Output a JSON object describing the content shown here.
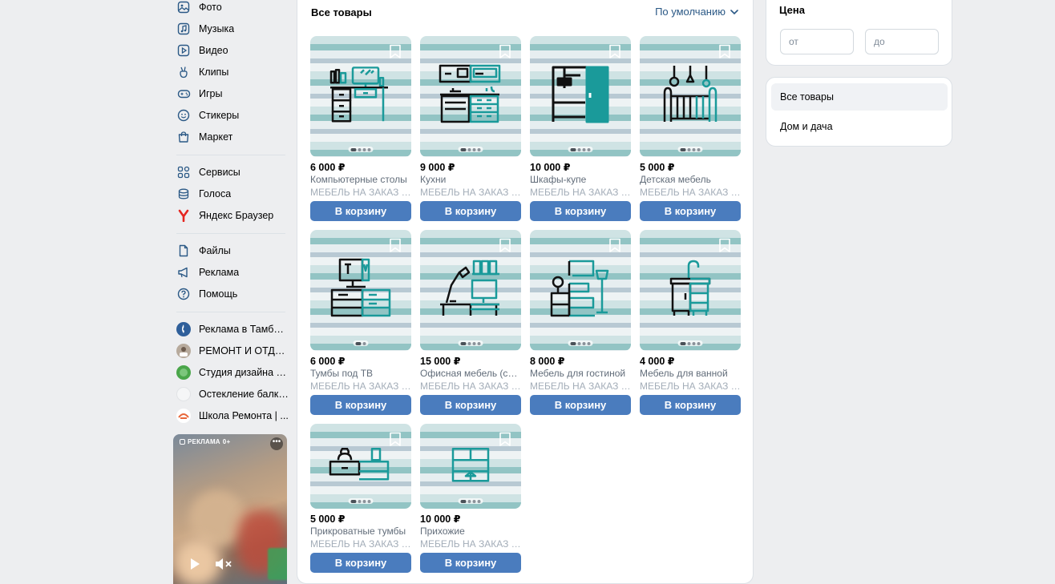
{
  "nav": {
    "items": [
      {
        "label": "Фото",
        "icon": "photo-icon"
      },
      {
        "label": "Музыка",
        "icon": "music-icon"
      },
      {
        "label": "Видео",
        "icon": "video-icon"
      },
      {
        "label": "Клипы",
        "icon": "clips-icon"
      },
      {
        "label": "Игры",
        "icon": "gamepad-icon"
      },
      {
        "label": "Стикеры",
        "icon": "sticker-icon"
      },
      {
        "label": "Маркет",
        "icon": "market-icon"
      },
      {
        "label": "Сервисы",
        "icon": "services-icon"
      },
      {
        "label": "Голоса",
        "icon": "coins-icon"
      },
      {
        "label": "Яндекс Браузер",
        "icon": "yandex-icon"
      },
      {
        "label": "Файлы",
        "icon": "file-icon"
      },
      {
        "label": "Реклама",
        "icon": "megaphone-icon"
      },
      {
        "label": "Помощь",
        "icon": "help-icon"
      }
    ],
    "groups": [
      {
        "label": "Реклама в Тамбове",
        "color": "#2f5f9a"
      },
      {
        "label": "РЕМОНТ И ОТДЕЛКА",
        "color": "#9a8a7a"
      },
      {
        "label": "Студия дизайна интерьера",
        "color": "#4aa64a"
      },
      {
        "label": "Остекление балконов",
        "color": "#eceef0"
      },
      {
        "label": "Школа Ремонта | ...",
        "color": "#e8673a"
      }
    ]
  },
  "ad": {
    "label": "РЕКЛАМА",
    "age": "0+"
  },
  "main": {
    "title": "Все товары",
    "sort_label": "По умолчанию",
    "cart_label": "В корзину",
    "products": [
      {
        "price": "6 000 ₽",
        "name": "Компьютерные столы",
        "shop": "МЕБЕЛЬ НА ЗАКАЗ — ТАМБОВ",
        "icon": "computer-desk-icon",
        "dots": 4
      },
      {
        "price": "9 000 ₽",
        "name": "Кухни",
        "shop": "МЕБЕЛЬ НА ЗАКАЗ — ТАМБОВ",
        "icon": "kitchen-icon",
        "dots": 4
      },
      {
        "price": "10 000 ₽",
        "name": "Шкафы-купе",
        "shop": "МЕБЕЛЬ НА ЗАКАЗ — ТАМБОВ",
        "icon": "wardrobe-icon",
        "dots": 4
      },
      {
        "price": "5 000 ₽",
        "name": "Детская мебель",
        "shop": "МЕБЕЛЬ НА ЗАКАЗ — ТАМБОВ",
        "icon": "crib-icon",
        "dots": 4
      },
      {
        "price": "6 000 ₽",
        "name": "Тумбы под ТВ",
        "shop": "МЕБЕЛЬ НА ЗАКАЗ — ТАМБОВ",
        "icon": "tv-stand-icon",
        "dots": 2
      },
      {
        "price": "15 000 ₽",
        "name": "Офисная мебель (столы)",
        "shop": "МЕБЕЛЬ НА ЗАКАЗ — ТАМБОВ",
        "icon": "office-desk-icon",
        "dots": 4
      },
      {
        "price": "8 000 ₽",
        "name": "Мебель для гостиной",
        "shop": "МЕБЕЛЬ НА ЗАКАЗ — ТАМБОВ",
        "icon": "living-room-icon",
        "dots": 4
      },
      {
        "price": "4 000 ₽",
        "name": "Мебель для ванной",
        "shop": "МЕБЕЛЬ НА ЗАКАЗ — ТАМБОВ",
        "icon": "bathroom-sink-icon",
        "dots": 4
      },
      {
        "price": "5 000 ₽",
        "name": "Прикроватные тумбы",
        "shop": "МЕБЕЛЬ НА ЗАКАЗ — ТАМБОВ",
        "icon": "nightstand-icon",
        "dots": 4
      },
      {
        "price": "10 000 ₽",
        "name": "Прихожие",
        "shop": "МЕБЕЛЬ НА ЗАКАЗ — ТАМБОВ",
        "icon": "hallway-icon",
        "dots": 4
      }
    ]
  },
  "filters": {
    "price_title": "Цена",
    "from_placeholder": "от",
    "to_placeholder": "до",
    "categories": [
      "Все товары",
      "Дом и дача"
    ]
  },
  "colors": {
    "accent": "#4a7cbe",
    "link": "#2a5885",
    "teal": "#1a9a9a"
  }
}
